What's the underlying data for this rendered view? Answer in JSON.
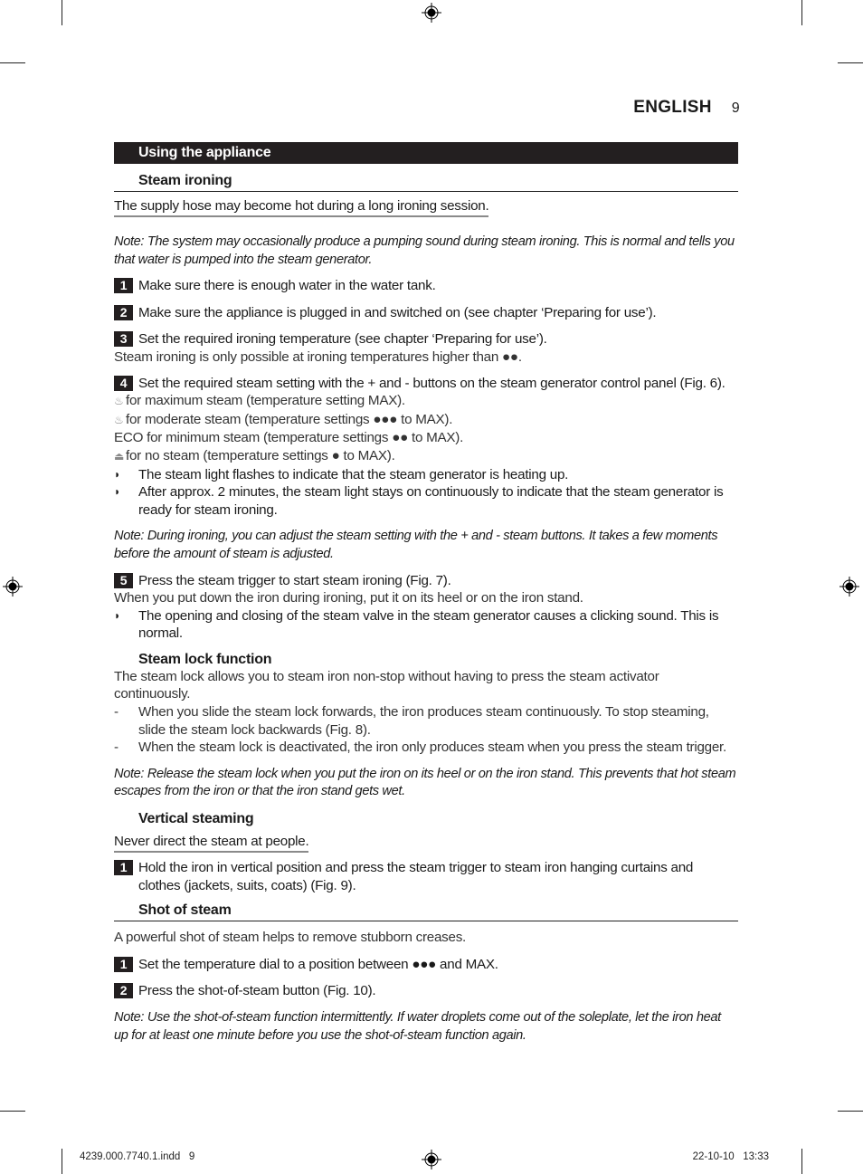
{
  "header": {
    "language": "ENGLISH",
    "page_number": "9"
  },
  "section_title": "Using the appliance",
  "steam_ironing": {
    "heading": "Steam ironing",
    "warning": "The supply hose may become hot during a long ironing session.",
    "note1": "Note: The system may occasionally produce a pumping sound during steam ironing. This is normal and tells you that water is pumped into the steam generator.",
    "steps": [
      {
        "num": "1",
        "text": "Make sure there is enough water in the water tank."
      },
      {
        "num": "2",
        "text": "Make sure the appliance is plugged in and switched on (see chapter ‘Preparing for use’)."
      },
      {
        "num": "3",
        "text": "Set the required ironing temperature (see chapter ‘Preparing for use’).",
        "sub": "Steam ironing is only possible at ironing temperatures higher than ●●."
      },
      {
        "num": "4",
        "text": "Set the required steam setting with the + and - buttons on the steam generator control panel (Fig. 6)."
      }
    ],
    "steam_settings": [
      {
        "icon": "max-steam-icon",
        "glyph": "♨",
        "text": "for maximum steam (temperature setting MAX)."
      },
      {
        "icon": "moderate-steam-icon",
        "glyph": "♨",
        "text": "for moderate steam (temperature settings ●●● to MAX)."
      },
      {
        "icon": "",
        "glyph": "",
        "text": "ECO for minimum steam (temperature settings ●● to MAX)."
      },
      {
        "icon": "no-steam-icon",
        "glyph": "⏏",
        "text": "for no steam (temperature settings ● to MAX)."
      }
    ],
    "bullets1": [
      "The steam light flashes to indicate that the steam generator is heating up.",
      "After approx. 2 minutes, the steam light stays on continuously to indicate that the steam generator is ready for steam ironing."
    ],
    "note2": "Note: During ironing, you can adjust the steam setting with the + and - steam buttons. It takes a few moments before the amount of steam is adjusted.",
    "step5": {
      "num": "5",
      "text": "Press the steam trigger to start steam ironing (Fig. 7).",
      "sub": "When you put down the iron during ironing, put it on its heel or on the iron stand."
    },
    "bullets2": [
      "The opening and closing of the steam valve in the steam generator causes a clicking sound. This is normal."
    ]
  },
  "steam_lock": {
    "heading": "Steam lock function",
    "intro": "The steam lock allows you to steam iron non-stop without having to press the steam activator continuously.",
    "dashes": [
      "When you slide the steam lock forwards, the iron produces steam continuously. To stop steaming, slide the steam lock backwards (Fig. 8).",
      "When the steam lock is deactivated, the iron only produces steam when you press the steam trigger."
    ],
    "note": "Note: Release the steam lock when you put the iron on its heel or on the iron stand. This prevents that hot steam escapes from the iron or that the iron stand gets wet."
  },
  "vertical_steaming": {
    "heading": "Vertical steaming",
    "warning": "Never direct the steam at people.",
    "steps": [
      {
        "num": "1",
        "text": "Hold the iron in vertical position and press the steam trigger to steam iron hanging curtains and clothes (jackets, suits, coats) (Fig. 9)."
      }
    ]
  },
  "shot_of_steam": {
    "heading": "Shot of steam",
    "intro": "A powerful shot of steam helps to remove stubborn creases.",
    "steps": [
      {
        "num": "1",
        "text": "Set the temperature dial to a position between ●●● and MAX."
      },
      {
        "num": "2",
        "text": "Press the shot-of-steam button (Fig. 10)."
      }
    ],
    "note": "Note: Use the shot-of-steam function intermittently. If water droplets come out of the soleplate, let the iron heat up for at least one minute before you use the shot-of-steam function again."
  },
  "footer": {
    "file": "4239.000.7740.1.indd   9",
    "datetime": "22-10-10   13:33"
  },
  "markers": {
    "bullet_glyph": "◗",
    "dash_glyph": "-"
  }
}
